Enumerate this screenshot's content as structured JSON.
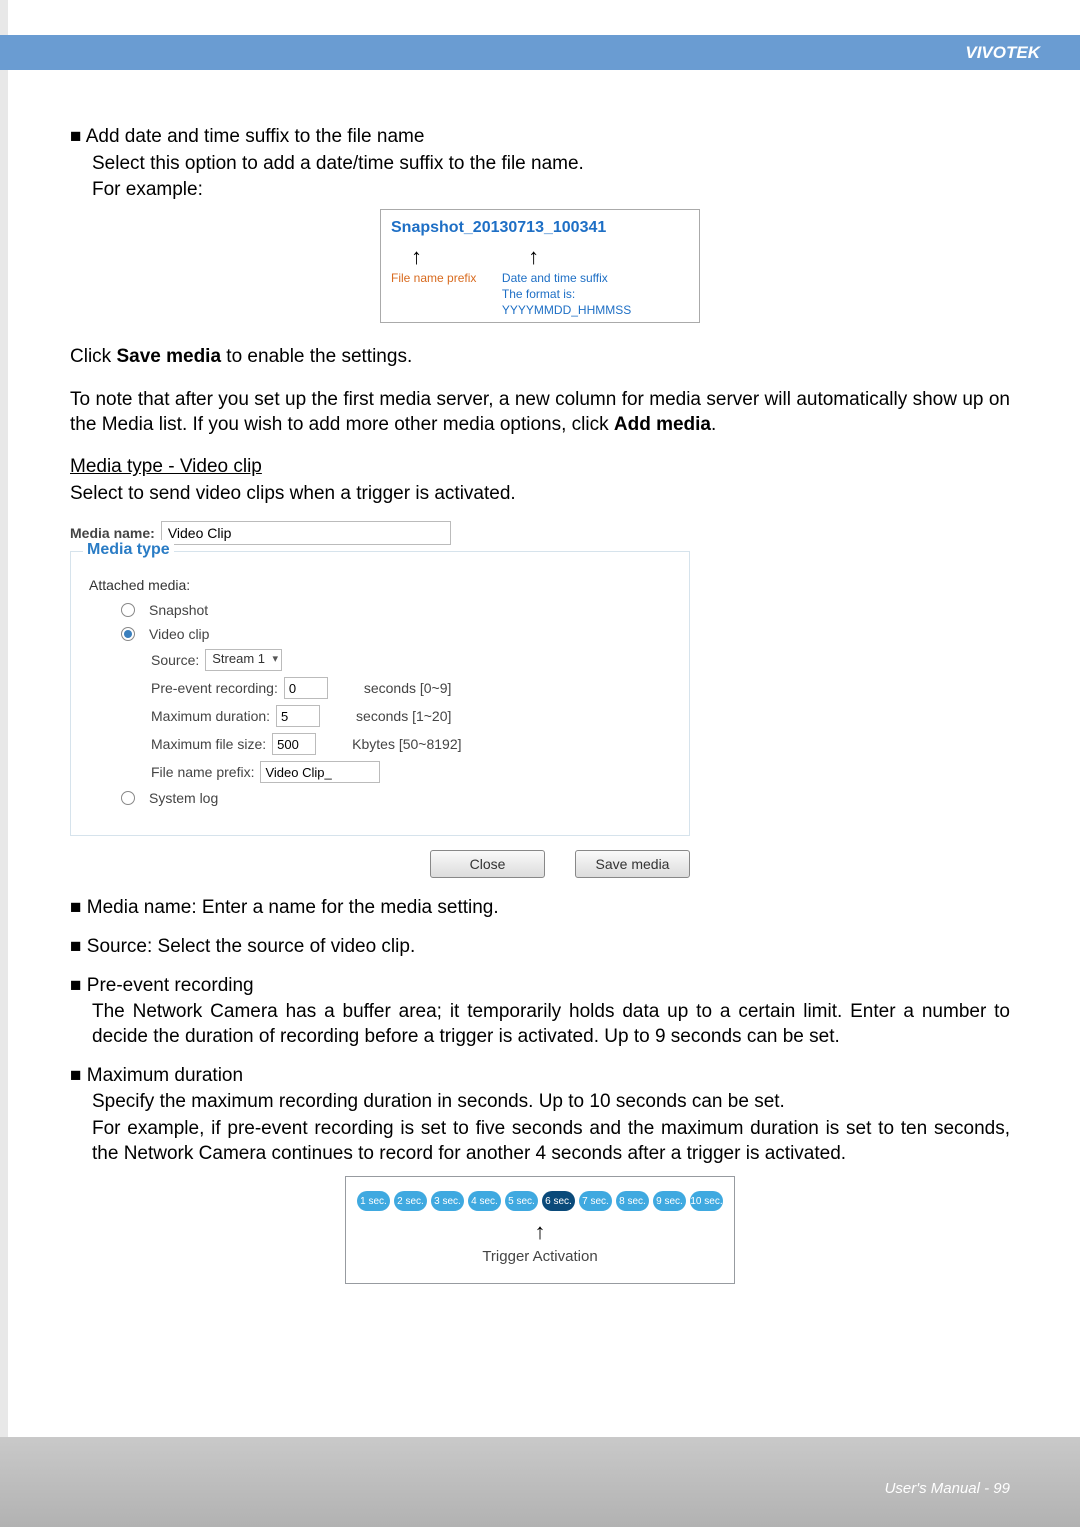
{
  "brand": "VIVOTEK",
  "section1": {
    "bullet": "■",
    "title": "Add date and time suffix to the file name",
    "line1": "Select this option to add a date/time suffix to the file name.",
    "line2": "For example:"
  },
  "snapshot": {
    "title": "Snapshot_20130713_100341",
    "prefix_label": "File name prefix",
    "suffix_label": "Date and time suffix",
    "format_label": "The format is: YYYYMMDD_HHMMSS"
  },
  "click_save": {
    "pre": "Click ",
    "bold": "Save media",
    "post": " to enable the settings."
  },
  "note": {
    "part1": "To note that after you set up the first media server, a new column for media server will automatically show up on the Media list.  If you wish to add more other media options, click ",
    "bold": "Add media",
    "part2": "."
  },
  "media_header": "Media type - Video clip",
  "media_sub": "Select to send video clips when a trigger is activated.",
  "ui": {
    "media_name_label": "Media name:",
    "media_name_value": "Video Clip",
    "legend": "Media type",
    "attached_label": "Attached media:",
    "opt_snapshot": "Snapshot",
    "opt_videoclip": "Video clip",
    "source_label": "Source:",
    "source_value": "Stream 1",
    "pre_event_label": "Pre-event recording:",
    "pre_event_value": "0",
    "pre_event_range": "seconds [0~9]",
    "max_dur_label": "Maximum duration:",
    "max_dur_value": "5",
    "max_dur_range": "seconds [1~20]",
    "max_size_label": "Maximum file size:",
    "max_size_value": "500",
    "max_size_range": "Kbytes [50~8192]",
    "prefix_label": "File name prefix:",
    "prefix_value": "Video Clip_",
    "opt_syslog": "System log",
    "btn_close": "Close",
    "btn_save": "Save media"
  },
  "bullets": {
    "b1": "Media name: Enter a name for the media setting.",
    "b2": "Source: Select the source of video clip.",
    "b3_title": "Pre-event recording",
    "b3_body": "The Network Camera has a buffer area; it temporarily holds data up to a certain limit. Enter a number to decide the duration of recording before a trigger is activated. Up to 9 seconds can be set.",
    "b4_title": "Maximum duration",
    "b4_l1": "Specify the maximum recording duration in seconds. Up to 10 seconds can be set.",
    "b4_l2": "For example, if pre-event recording is set to five seconds and the maximum duration is set to ten seconds, the Network Camera continues to record for another 4 seconds after a trigger is activated."
  },
  "trigger": {
    "labels": [
      "1 sec.",
      "2 sec.",
      "3 sec.",
      "4 sec.",
      "5 sec.",
      "6 sec.",
      "7 sec.",
      "8 sec.",
      "9 sec.",
      "10 sec."
    ],
    "dark_index": 5,
    "caption": "Trigger Activation"
  },
  "footer": {
    "text": "User's Manual - 99"
  }
}
